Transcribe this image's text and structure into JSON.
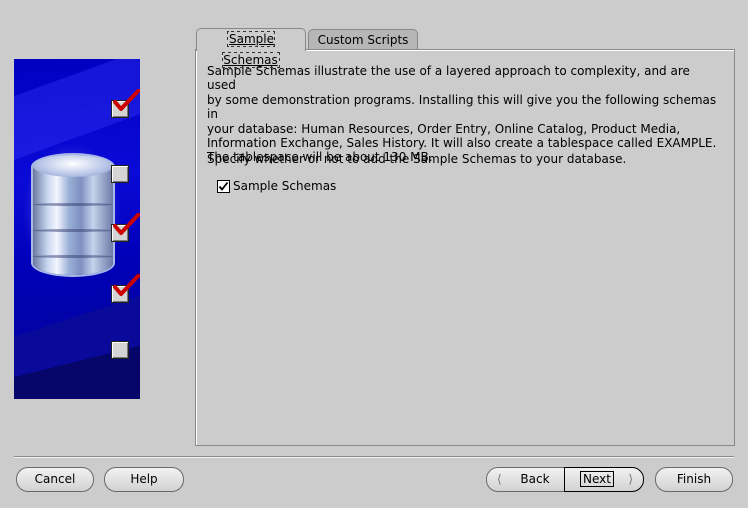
{
  "side_panel": {
    "steps": [
      {
        "state": "checked"
      },
      {
        "state": "unchecked"
      },
      {
        "state": "checked"
      },
      {
        "state": "checked"
      },
      {
        "state": "unchecked"
      }
    ]
  },
  "tabs": [
    {
      "label": "Sample Schemas",
      "active": true
    },
    {
      "label": "Custom Scripts",
      "active": false
    }
  ],
  "panel": {
    "description_lines": [
      "Sample Schemas illustrate the use of a layered approach to complexity, and are used",
      "by some demonstration programs. Installing this will give you the following schemas in",
      "your database: Human Resources, Order Entry, Online Catalog, Product Media,",
      "Information Exchange, Sales History. It will also create a tablespace called EXAMPLE.",
      "The tablespace will be about 130 MB."
    ],
    "prompt": "Specify whether or not to add the Sample Schemas to your database.",
    "checkbox": {
      "label": "Sample Schemas",
      "checked": true
    }
  },
  "buttons": {
    "cancel": "Cancel",
    "help": "Help",
    "back": "Back",
    "next": "Next",
    "finish": "Finish"
  },
  "colors": {
    "panel_blue": "#0000c0",
    "tick_red": "#cc0000",
    "background": "#cccccc"
  }
}
